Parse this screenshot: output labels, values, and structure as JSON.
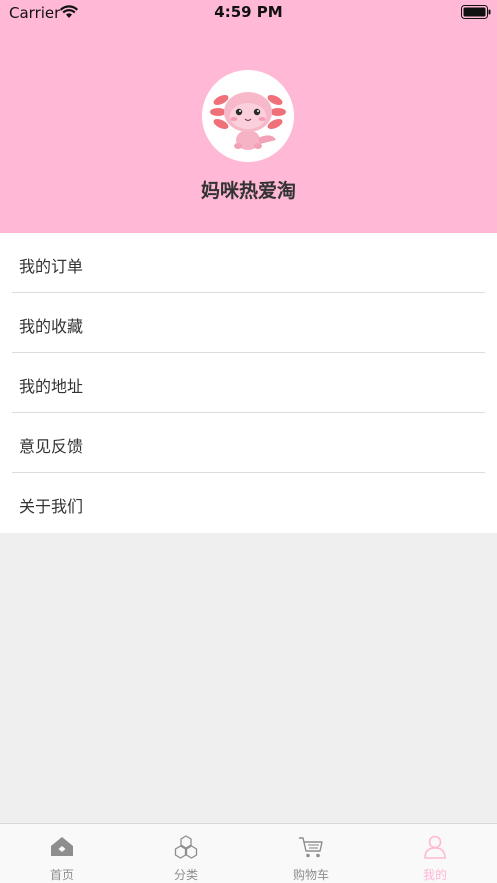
{
  "status_bar": {
    "carrier": "Carrier",
    "time": "4:59 PM",
    "wifi_icon": "wifi-icon",
    "battery_icon": "battery-icon"
  },
  "profile": {
    "avatar_icon": "axolotl-avatar",
    "username": "妈咪热爱淘",
    "header_color": "#ffb8d5"
  },
  "menu": {
    "items": [
      {
        "label": "我的订单"
      },
      {
        "label": "我的收藏"
      },
      {
        "label": "我的地址"
      },
      {
        "label": "意见反馈"
      },
      {
        "label": "关于我们"
      }
    ]
  },
  "tabbar": {
    "active_color": "#ffb8d5",
    "inactive_color": "#8e8e8e",
    "tabs": [
      {
        "label": "首页",
        "icon": "home-icon",
        "active": false
      },
      {
        "label": "分类",
        "icon": "category-icon",
        "active": false
      },
      {
        "label": "购物车",
        "icon": "cart-icon",
        "active": false
      },
      {
        "label": "我的",
        "icon": "profile-icon",
        "active": true
      }
    ]
  }
}
